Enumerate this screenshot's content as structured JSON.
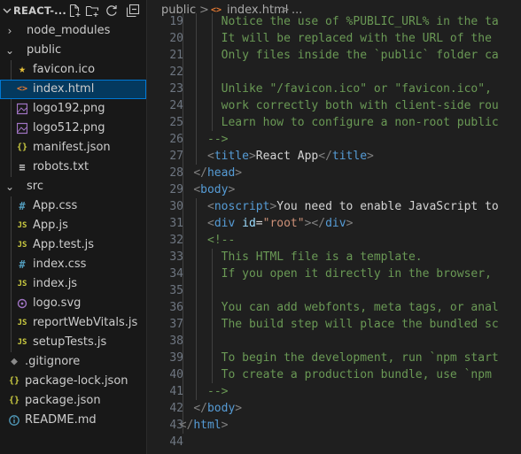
{
  "explorer": {
    "title": "REACT-...",
    "actions": [
      "new-file-icon",
      "new-folder-icon",
      "refresh-icon",
      "collapse-all-icon"
    ],
    "tree": [
      {
        "label": "node_modules",
        "kind": "folder",
        "state": "collapsed",
        "depth": 0
      },
      {
        "label": "public",
        "kind": "folder",
        "state": "expanded",
        "depth": 0
      },
      {
        "label": "favicon.ico",
        "kind": "file",
        "icon": "star-icon",
        "depth": 1
      },
      {
        "label": "index.html",
        "kind": "file",
        "icon": "html-file-icon",
        "depth": 1,
        "selected": true
      },
      {
        "label": "logo192.png",
        "kind": "file",
        "icon": "image-file-icon",
        "depth": 1
      },
      {
        "label": "logo512.png",
        "kind": "file",
        "icon": "image-file-icon",
        "depth": 1
      },
      {
        "label": "manifest.json",
        "kind": "file",
        "icon": "json-file-icon",
        "depth": 1
      },
      {
        "label": "robots.txt",
        "kind": "file",
        "icon": "text-file-icon",
        "depth": 1
      },
      {
        "label": "src",
        "kind": "folder",
        "state": "expanded",
        "depth": 0
      },
      {
        "label": "App.css",
        "kind": "file",
        "icon": "css-file-icon",
        "depth": 1
      },
      {
        "label": "App.js",
        "kind": "file",
        "icon": "js-file-icon",
        "depth": 1
      },
      {
        "label": "App.test.js",
        "kind": "file",
        "icon": "js-file-icon",
        "depth": 1
      },
      {
        "label": "index.css",
        "kind": "file",
        "icon": "css-file-icon",
        "depth": 1
      },
      {
        "label": "index.js",
        "kind": "file",
        "icon": "js-file-icon",
        "depth": 1
      },
      {
        "label": "logo.svg",
        "kind": "file",
        "icon": "svg-file-icon",
        "depth": 1
      },
      {
        "label": "reportWebVitals.js",
        "kind": "file",
        "icon": "js-file-icon",
        "depth": 1
      },
      {
        "label": "setupTests.js",
        "kind": "file",
        "icon": "js-file-icon",
        "depth": 1
      },
      {
        "label": ".gitignore",
        "kind": "file",
        "icon": "git-file-icon",
        "depth": 0
      },
      {
        "label": "package-lock.json",
        "kind": "file",
        "icon": "json-file-icon",
        "depth": 0
      },
      {
        "label": "package.json",
        "kind": "file",
        "icon": "json-file-icon",
        "depth": 0
      },
      {
        "label": "README.md",
        "kind": "file",
        "icon": "info-file-icon",
        "depth": 0
      }
    ]
  },
  "breadcrumb": {
    "folder": "public",
    "separator": ">",
    "file": "index.html",
    "more": "..."
  },
  "editor": {
    "lines": [
      {
        "n": "19",
        "indent": 1,
        "tokens": [
          [
            "cm",
            "Notice the use of %PUBLIC_URL% in the ta"
          ]
        ]
      },
      {
        "n": "20",
        "indent": 1,
        "tokens": [
          [
            "cm",
            "It will be replaced with the URL of the"
          ]
        ]
      },
      {
        "n": "21",
        "indent": 1,
        "tokens": [
          [
            "cm",
            "Only files inside the `public` folder ca"
          ]
        ]
      },
      {
        "n": "22",
        "indent": 0,
        "tokens": []
      },
      {
        "n": "23",
        "indent": 1,
        "tokens": [
          [
            "cm",
            "Unlike \"/favicon.ico\" or \"favicon.ico\","
          ]
        ]
      },
      {
        "n": "24",
        "indent": 1,
        "tokens": [
          [
            "cm",
            "work correctly both with client-side rou"
          ]
        ]
      },
      {
        "n": "25",
        "indent": 1,
        "tokens": [
          [
            "cm",
            "Learn how to configure a non-root public"
          ]
        ]
      },
      {
        "n": "26",
        "indent": 0,
        "tokens": [
          [
            "cm",
            "-->"
          ]
        ]
      },
      {
        "n": "27",
        "indent": 0,
        "tokens": [
          [
            "br",
            "<"
          ],
          [
            "tag",
            "title"
          ],
          [
            "br",
            ">"
          ],
          [
            "txt",
            "React App"
          ],
          [
            "br",
            "</"
          ],
          [
            "tag",
            "title"
          ],
          [
            "br",
            ">"
          ]
        ]
      },
      {
        "n": "28",
        "indent": -1,
        "tokens": [
          [
            "br",
            "</"
          ],
          [
            "tag",
            "head"
          ],
          [
            "br",
            ">"
          ]
        ]
      },
      {
        "n": "29",
        "indent": -1,
        "tokens": [
          [
            "br",
            "<"
          ],
          [
            "tag",
            "body"
          ],
          [
            "br",
            ">"
          ]
        ]
      },
      {
        "n": "30",
        "indent": 0,
        "tokens": [
          [
            "br",
            "<"
          ],
          [
            "tag",
            "noscript"
          ],
          [
            "br",
            ">"
          ],
          [
            "txt",
            "You need to enable JavaScript to"
          ]
        ]
      },
      {
        "n": "31",
        "indent": 0,
        "tokens": [
          [
            "br",
            "<"
          ],
          [
            "tag",
            "div"
          ],
          [
            "txt",
            " "
          ],
          [
            "attr",
            "id"
          ],
          [
            "txt",
            "="
          ],
          [
            "str",
            "\"root\""
          ],
          [
            "br",
            "></"
          ],
          [
            "tag",
            "div"
          ],
          [
            "br",
            ">"
          ]
        ]
      },
      {
        "n": "32",
        "indent": 0,
        "tokens": [
          [
            "cm",
            "<!--"
          ]
        ]
      },
      {
        "n": "33",
        "indent": 1,
        "tokens": [
          [
            "cm",
            "This HTML file is a template."
          ]
        ]
      },
      {
        "n": "34",
        "indent": 1,
        "tokens": [
          [
            "cm",
            "If you open it directly in the browser,"
          ]
        ]
      },
      {
        "n": "35",
        "indent": 0,
        "tokens": []
      },
      {
        "n": "36",
        "indent": 1,
        "tokens": [
          [
            "cm",
            "You can add webfonts, meta tags, or anal"
          ]
        ]
      },
      {
        "n": "37",
        "indent": 1,
        "tokens": [
          [
            "cm",
            "The build step will place the bundled sc"
          ]
        ]
      },
      {
        "n": "38",
        "indent": 0,
        "tokens": []
      },
      {
        "n": "39",
        "indent": 1,
        "tokens": [
          [
            "cm",
            "To begin the development, run `npm start"
          ]
        ]
      },
      {
        "n": "40",
        "indent": 1,
        "tokens": [
          [
            "cm",
            "To create a production bundle, use `npm"
          ]
        ]
      },
      {
        "n": "41",
        "indent": 0,
        "tokens": [
          [
            "cm",
            "-->"
          ]
        ]
      },
      {
        "n": "42",
        "indent": -1,
        "tokens": [
          [
            "br",
            "</"
          ],
          [
            "tag",
            "body"
          ],
          [
            "br",
            ">"
          ]
        ]
      },
      {
        "n": "43",
        "indent": -2,
        "tokens": [
          [
            "br",
            "</"
          ],
          [
            "tag",
            "html"
          ],
          [
            "br",
            ">"
          ]
        ]
      },
      {
        "n": "44",
        "indent": 0,
        "tokens": []
      }
    ]
  },
  "colors": {
    "selection_bg": "#04395e",
    "selection_border": "#0078d4",
    "sidebar_bg": "#181818",
    "editor_bg": "#1f1f1f",
    "comment": "#6a9955",
    "tag": "#569cd6",
    "bracket": "#808080",
    "attribute": "#9cdcfe",
    "string": "#ce9178"
  }
}
